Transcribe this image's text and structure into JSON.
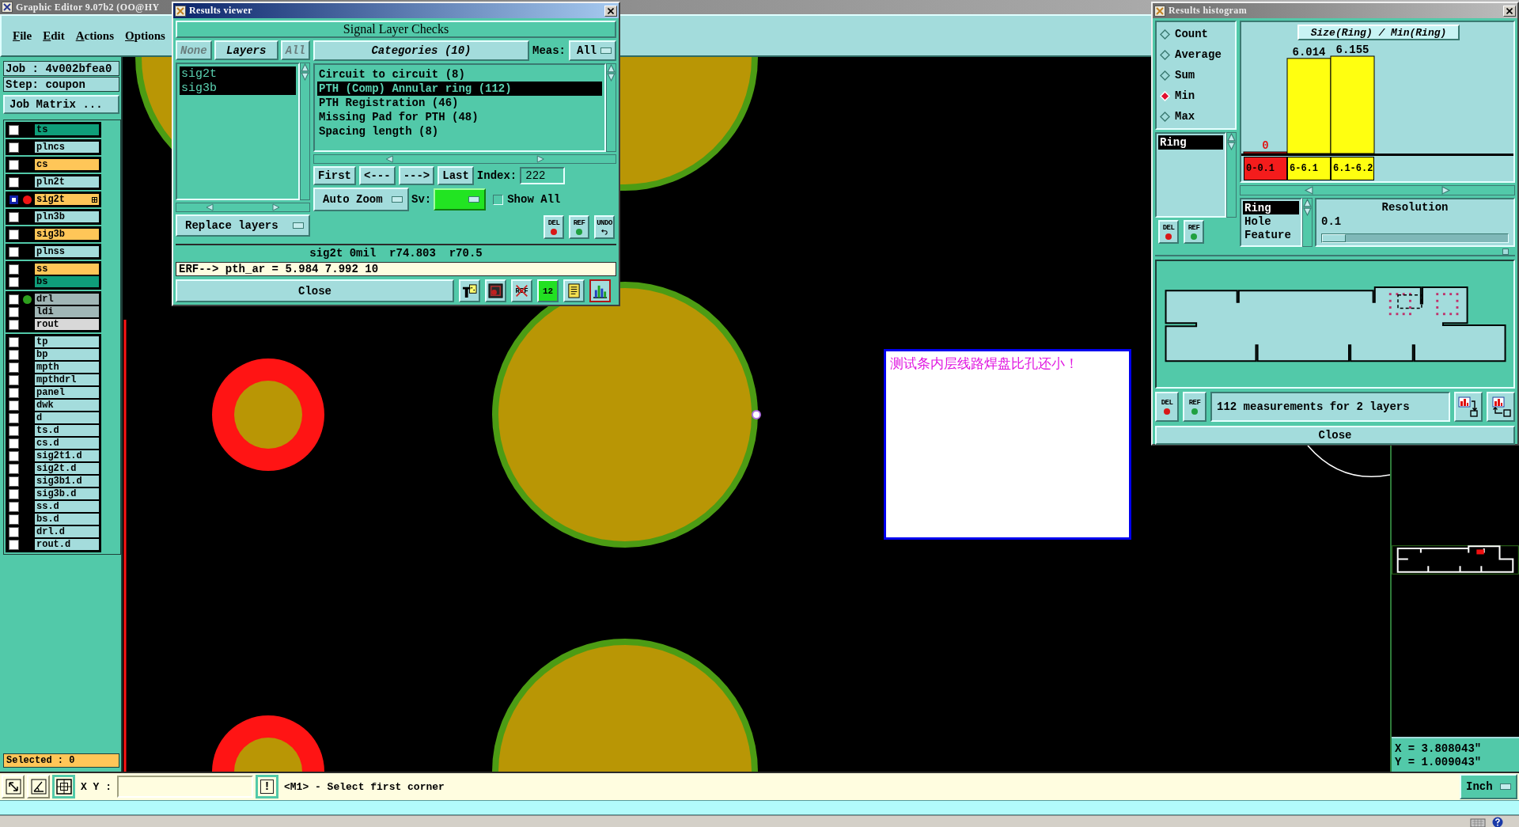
{
  "main_window": {
    "title": "Graphic Editor 9.07b2 (OO@HY",
    "active": false
  },
  "menu": [
    "File",
    "Edit",
    "Actions",
    "Options"
  ],
  "job_panel": {
    "job": "Job : 4v002bfea0",
    "step": "Step: coupon",
    "matrix_button": "Job Matrix ..."
  },
  "layer_groups": [
    {
      "layers": [
        {
          "name": "ts",
          "color": "#0f9e7a",
          "selected": false
        }
      ]
    },
    {
      "layers": [
        {
          "name": "plncs",
          "color": "#a4dcdc",
          "selected": false
        }
      ]
    },
    {
      "layers": [
        {
          "name": "cs",
          "color": "#ffc658",
          "selected": false
        }
      ]
    },
    {
      "layers": [
        {
          "name": "pln2t",
          "color": "#a4dcdc",
          "selected": false
        }
      ]
    },
    {
      "layers": [
        {
          "name": "sig2t",
          "color": "#ffc658",
          "selected": true,
          "dot": {
            "color": "#f01414"
          }
        }
      ]
    },
    {
      "layers": [
        {
          "name": "pln3b",
          "color": "#a4dcdc",
          "selected": false
        }
      ]
    },
    {
      "layers": [
        {
          "name": "sig3b",
          "color": "#ffc658",
          "selected": false
        }
      ]
    },
    {
      "layers": [
        {
          "name": "plnss",
          "color": "#a4dcdc",
          "selected": false
        }
      ]
    },
    {
      "layers": [
        {
          "name": "ss",
          "color": "#ffc658",
          "selected": false
        },
        {
          "name": "bs",
          "color": "#0f9e7a",
          "selected": false
        }
      ]
    },
    {
      "layers": [
        {
          "name": "drl",
          "color": "#a0b6b6",
          "selected": false,
          "dot": {
            "color": "#2ea01e"
          }
        },
        {
          "name": "ldi",
          "color": "#a0b6b6",
          "selected": false
        },
        {
          "name": "rout",
          "color": "#d8d8d8",
          "selected": false
        }
      ]
    },
    {
      "layers": [
        {
          "name": "tp",
          "color": "#a4dcdc",
          "selected": false
        },
        {
          "name": "bp",
          "color": "#a4dcdc",
          "selected": false
        },
        {
          "name": "mpth",
          "color": "#a4dcdc",
          "selected": false
        },
        {
          "name": "mpthdrl",
          "color": "#a4dcdc",
          "selected": false
        },
        {
          "name": "panel",
          "color": "#a4dcdc",
          "selected": false
        },
        {
          "name": "dwk",
          "color": "#a4dcdc",
          "selected": false
        },
        {
          "name": "d",
          "color": "#a4dcdc",
          "selected": false
        },
        {
          "name": "ts.d",
          "color": "#a4dcdc",
          "selected": false
        },
        {
          "name": "cs.d",
          "color": "#a4dcdc",
          "selected": false
        },
        {
          "name": "sig2t1.d",
          "color": "#a4dcdc",
          "selected": false
        },
        {
          "name": "sig2t.d",
          "color": "#a4dcdc",
          "selected": false
        },
        {
          "name": "sig3b1.d",
          "color": "#a4dcdc",
          "selected": false
        },
        {
          "name": "sig3b.d",
          "color": "#a4dcdc",
          "selected": false
        },
        {
          "name": "ss.d",
          "color": "#a4dcdc",
          "selected": false
        },
        {
          "name": "bs.d",
          "color": "#a4dcdc",
          "selected": false
        },
        {
          "name": "drl.d",
          "color": "#a4dcdc",
          "selected": false
        },
        {
          "name": "rout.d",
          "color": "#a4dcdc",
          "selected": false
        }
      ]
    }
  ],
  "selected_count": "Selected : 0",
  "toolbar": {
    "tools": [
      {
        "kind": "arrow",
        "selected": false
      },
      {
        "kind": "angle",
        "selected": false
      },
      {
        "kind": "grid",
        "selected": true
      }
    ],
    "xy_label": "X Y :",
    "alert_button": "!",
    "prompt": "<M1> - Select first corner",
    "units": "Inch"
  },
  "navigator": {
    "x_readout": "X = 3.808043\"",
    "y_readout": "Y = 1.009043\""
  },
  "message_box": {
    "text": "测试条内层线路焊盘比孔还小！"
  },
  "results_viewer": {
    "title": "Results viewer",
    "active": true,
    "heading": "Signal Layer Checks",
    "layer_filter": [
      {
        "label": "None",
        "selected": false
      },
      {
        "label": "Layers",
        "selected": true
      },
      {
        "label": "All",
        "selected": false
      }
    ],
    "layers": [
      {
        "name": "sig2t",
        "selected": true
      },
      {
        "name": "sig3b",
        "selected": true
      }
    ],
    "replace_dropdown": "Replace layers",
    "categories_button": "Categories (10)",
    "meas_label": "Meas:",
    "meas_dropdown": "All",
    "categories": [
      {
        "label": "Circuit to circuit (8)",
        "selected": false
      },
      {
        "label": "PTH (Comp) Annular ring (112)",
        "selected": true
      },
      {
        "label": "PTH Registration (46)",
        "selected": false
      },
      {
        "label": "Missing Pad for PTH (48)",
        "selected": false
      },
      {
        "label": "Spacing length (8)",
        "selected": false
      }
    ],
    "nav_buttons": [
      "First",
      "<---",
      "--->",
      "Last"
    ],
    "index_label": "Index:",
    "index_value": "222",
    "zoom_dropdown": "Auto Zoom",
    "severity": {
      "label": "Sv:",
      "color": "#22e422"
    },
    "show_all": {
      "label": "Show All",
      "checked": false
    },
    "action_buttons": [
      {
        "kind": "del",
        "label": "DEL"
      },
      {
        "kind": "ref",
        "label": "REF"
      },
      {
        "kind": "undo",
        "label": "UNDO"
      }
    ],
    "info_line": "sig2t 0mil  r74.803  r70.5",
    "erf_line": "ERF--> pth_ar = 5.984 7.992 10",
    "close_button": "Close",
    "tool_buttons": [
      {
        "kind": "figure",
        "selected": false
      },
      {
        "kind": "marker",
        "selected": false
      },
      {
        "kind": "ref-crossed",
        "label": "REF",
        "selected": false
      },
      {
        "kind": "page",
        "label": "12",
        "selected": false
      },
      {
        "kind": "report",
        "selected": false
      },
      {
        "kind": "histogram",
        "selected": true
      }
    ]
  },
  "results_histogram": {
    "title": "Results histogram",
    "active": false,
    "modes": [
      {
        "label": "Count",
        "selected": false
      },
      {
        "label": "Average",
        "selected": false
      },
      {
        "label": "Sum",
        "selected": false
      },
      {
        "label": "Min",
        "selected": true
      },
      {
        "label": "Max",
        "selected": false
      }
    ],
    "attributes": [
      {
        "label": "Ring",
        "selected": true
      }
    ],
    "list_buttons": [
      {
        "kind": "del",
        "label": "DEL"
      },
      {
        "kind": "ref",
        "label": "REF"
      }
    ],
    "chart_data": {
      "type": "bar",
      "title": "Size(Ring) / Min(Ring)",
      "categories": [
        "0-0.1",
        "6-6.1",
        "6.1-6.2"
      ],
      "values": [
        0,
        6.014,
        6.155
      ],
      "value_labels": [
        "0",
        "6.014",
        "6.155"
      ]
    },
    "bins": [
      {
        "failed": true
      },
      {
        "failed": false
      },
      {
        "failed": false
      }
    ],
    "fields": [
      {
        "label": "Ring",
        "selected": true
      },
      {
        "label": "Hole",
        "selected": false
      },
      {
        "label": "Feature",
        "selected": false
      }
    ],
    "resolution": {
      "title": "Resolution",
      "value": "0.1",
      "level": 0
    },
    "bottom_buttons": [
      {
        "kind": "del",
        "label": "DEL"
      },
      {
        "kind": "ref",
        "label": "REF"
      }
    ],
    "summary": "112 measurements for 2 layers",
    "view_buttons": [
      {
        "kind": "to-view"
      },
      {
        "kind": "from-view"
      }
    ],
    "close_button": "Close"
  }
}
